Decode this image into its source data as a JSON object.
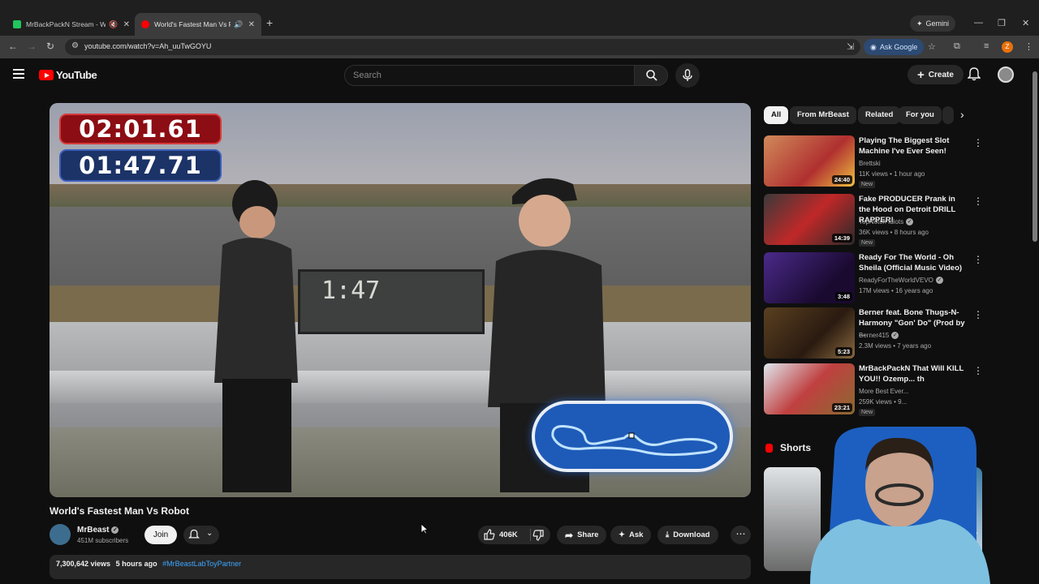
{
  "browser": {
    "tabs": [
      {
        "title": "MrBackPackN Stream - Wa",
        "active": false
      },
      {
        "title": "World's Fastest Man Vs Rob",
        "active": true
      }
    ],
    "gemini_label": "Gemini",
    "url": "youtube.com/watch?v=Ah_uuTwGOYU",
    "ask_google_label": "Ask Google",
    "profile_initial": "Z"
  },
  "youtube": {
    "logo_text": "YouTube",
    "search_placeholder": "Search",
    "create_label": "Create"
  },
  "video": {
    "timer_top": "02:01.61",
    "timer_bottom": "01:47.71",
    "title": "World's Fastest Man Vs Robot",
    "channel": "MrBeast",
    "subscribers": "451M subscribers",
    "join_label": "Join",
    "likes": "406K",
    "share_label": "Share",
    "ask_label": "Ask",
    "download_label": "Download",
    "views": "7,300,642 views",
    "age": "5 hours ago",
    "hashtag": "#MrBeastLabToyPartner"
  },
  "sidebar": {
    "chips": [
      "All",
      "From MrBeast",
      "Related",
      "For you"
    ],
    "videos": [
      {
        "title": "Playing The Biggest Slot Machine I've Ever Seen!",
        "channel": "Brettski",
        "meta": "11K views • 1 hour ago",
        "badge": "New",
        "duration": "24:40"
      },
      {
        "title": "Fake PRODUCER Prank in the Hood on Detroit DRILL RAPPER!",
        "channel": "TopNotch Idiots",
        "meta": "36K views • 8 hours ago",
        "badge": "New",
        "duration": "14:39"
      },
      {
        "title": "Ready For The World - Oh Sheila (Official Music Video)",
        "channel": "ReadyForTheWorldVEVO",
        "meta": "17M views • 16 years ago",
        "badge": "",
        "duration": "3:48"
      },
      {
        "title": "Berner feat. Bone Thugs-N-Harmony \"Gon' Do\" (Prod by ...",
        "channel": "Berner415",
        "meta": "2.3M views • 7 years ago",
        "badge": "",
        "duration": "5:23"
      },
      {
        "title": "MrBackPackN That Will KILL YOU!! Ozemp... th",
        "channel": "More Best Ever...",
        "meta": "259K views • 9...",
        "badge": "New",
        "duration": "23:21"
      }
    ],
    "shorts_label": "Shorts"
  }
}
